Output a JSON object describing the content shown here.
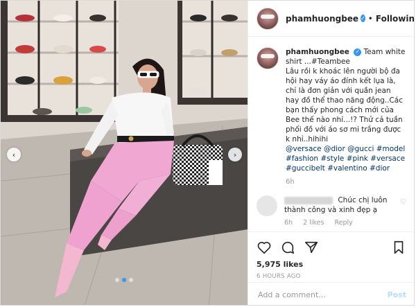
{
  "post": {
    "username": "phamhuongbee",
    "follow_state": "Following",
    "separator": "•",
    "caption_username": "phamhuongbee",
    "caption_lines": [
      "Team white shirt ...#Teambee",
      "Lâu rồi k khoác lên người bộ đa hội hay váy áo đính kết lụa là, chỉ là đơn giản với quần jean hay đồ thể thao năng động..Các bạn thấy phong cách mới của Bee thế nào nhỉ...!? Thử cả tuần phối đồ với áo sơ mi trắng được k nhỉ..hihihi"
    ],
    "tags_text": "@versace @dior @gucci #model #fashion #style #pink #versace #guccibelt #valentino #dior",
    "caption_time": "6h",
    "likes": "5,975 likes",
    "timestamp": "6 HOURS AGO",
    "add_comment_placeholder": "Add a comment...",
    "post_button": "Post"
  },
  "comment": {
    "text": "Chúc chị luôn thành công và xinh đẹp ạ",
    "time": "6h",
    "likes": "2 likes",
    "reply": "Reply"
  },
  "icons": {
    "verified": "verified-badge-icon",
    "like": "heart-icon",
    "comment": "comment-bubble-icon",
    "share": "share-icon",
    "save": "bookmark-icon",
    "prev": "chevron-left-icon",
    "next": "chevron-right-icon"
  },
  "colors": {
    "link": "#003569",
    "verified": "#3897f0",
    "muted": "#999999",
    "post_disabled": "#b2dffc"
  }
}
